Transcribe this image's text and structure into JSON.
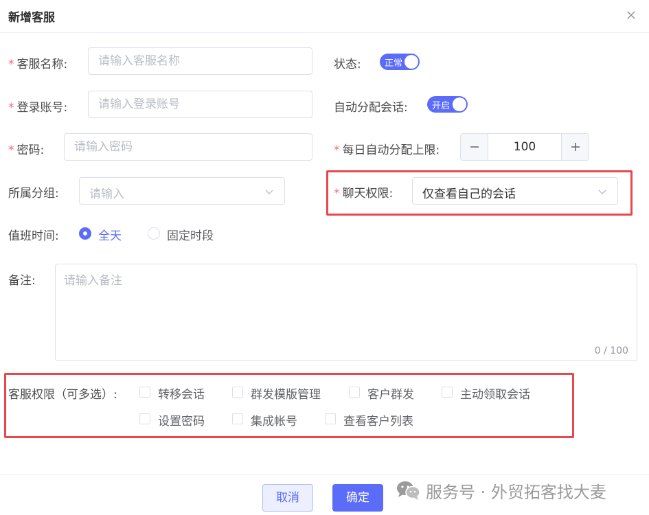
{
  "dialog": {
    "title": "新增客服"
  },
  "form": {
    "name": {
      "label": "客服名称:",
      "placeholder": "请输入客服名称"
    },
    "account": {
      "label": "登录账号:",
      "placeholder": "请输入登录账号"
    },
    "password": {
      "label": "密码:",
      "placeholder": "请输入密码"
    },
    "group": {
      "label": "所属分组:",
      "placeholder": "请输入"
    },
    "status": {
      "label": "状态:",
      "value": "正常"
    },
    "auto_assign": {
      "label": "自动分配会话:",
      "value": "开启"
    },
    "daily_limit": {
      "label": "每日自动分配上限:",
      "value": "100"
    },
    "chat_permission": {
      "label": "聊天权限:",
      "value": "仅查看自己的会话"
    },
    "duty_time": {
      "label": "值班时间:",
      "options": [
        "全天",
        "固定时段"
      ],
      "selected": "全天"
    },
    "remark": {
      "label": "备注:",
      "placeholder": "请输入备注",
      "counter": "0 / 100"
    },
    "permissions": {
      "label": "客服权限（可多选）:",
      "options": [
        "转移会话",
        "群发模版管理",
        "客户群发",
        "主动领取会话",
        "设置密码",
        "集成帐号",
        "查看客户列表"
      ]
    }
  },
  "required_mark": "*",
  "footer": {
    "cancel_label": "取消",
    "confirm_label": "确定"
  },
  "watermark": {
    "text": "服务号 · 外贸拓客找大麦",
    "icon": "wechat-icon"
  },
  "colors": {
    "primary": "#5b6cf9",
    "required": "#f56c6c",
    "highlight": "#e8484b",
    "placeholder": "#b8bcc4"
  }
}
